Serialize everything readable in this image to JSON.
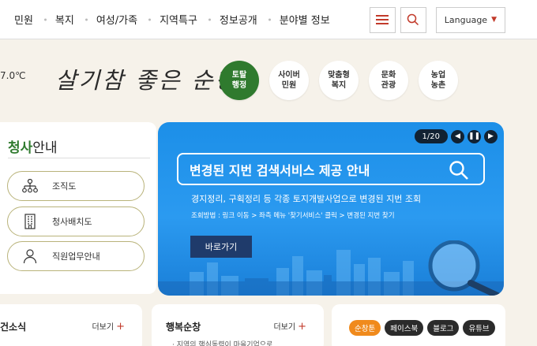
{
  "nav": {
    "items": [
      "민원",
      "복지",
      "여성/가족",
      "지역특구",
      "정보공개",
      "분야별 정보"
    ],
    "language_label": "Language"
  },
  "header": {
    "temperature": "7.0℃",
    "logo_text": "살기참 좋은 순창",
    "quick_links": [
      "토탈\n행정",
      "사이버\n민원",
      "맞춤형\n복지",
      "문화\n관광",
      "농업\n농촌"
    ]
  },
  "left_panel": {
    "title_accent": "청사",
    "title_rest": "안내",
    "buttons": [
      "조직도",
      "청사배치도",
      "직원업무안내"
    ]
  },
  "banner": {
    "counter": "1/20",
    "headline": "변경된 지번 검색서비스 제공 안내",
    "subtext": "경지정리, 구획정리 등 각종 토지개발사업으로 변경된 지번 조회",
    "desc": "조회방법 : 링크 이동 > 좌측 메뉴 '찾기서비스' 클릭 > 변경된 지번 찾기",
    "go_button": "바로가기"
  },
  "cards": {
    "card1_title": "건소식",
    "more_label": "더보기",
    "card2_title": "행복순창",
    "card2_sub": "· 지역의 핵심동력이 마을기업으로",
    "sns": [
      "순창툰",
      "페이스북",
      "블로그",
      "유튜브"
    ]
  },
  "colors": {
    "accent_green": "#2f7a2e",
    "accent_red": "#c23a2a",
    "banner_blue": "#1c8fe8"
  }
}
